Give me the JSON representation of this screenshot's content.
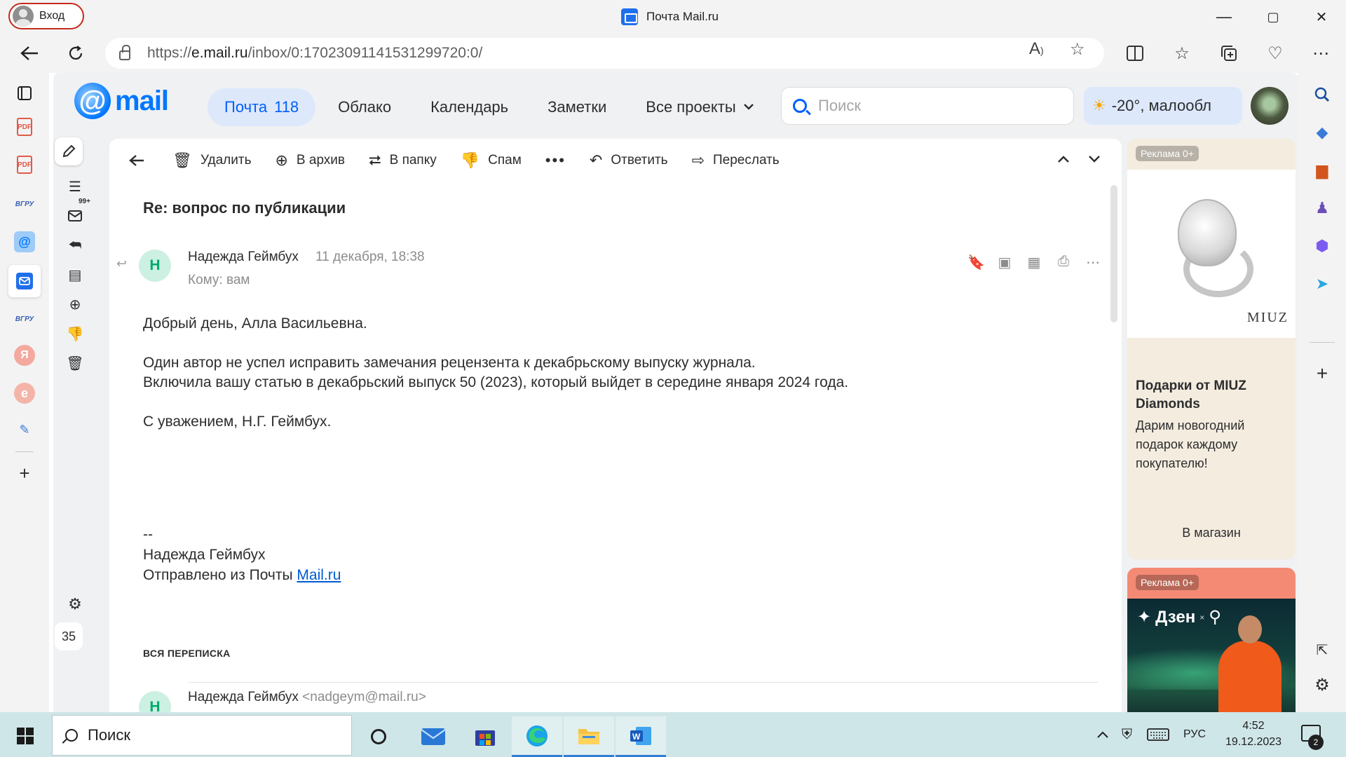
{
  "browser": {
    "profile_label": "Вход",
    "window_title": "Почта Mail.ru",
    "url_scheme": "https://",
    "url_host": "e.mail.ru",
    "url_path": "/inbox/0:17023091141531299720:0/",
    "window_controls": {
      "minimize": "—",
      "maximize": "▢",
      "close": "✕"
    }
  },
  "edge_left_icons": [
    "tabs-icon",
    "pdf-icon",
    "pdf-icon",
    "vgru-icon",
    "mailru-at-icon",
    "mail-icon",
    "vgru-icon",
    "yandex-icon",
    "edge-icon",
    "notes-icon",
    "add-icon"
  ],
  "edge_left_labels": {
    "vgru1": "ВГРУ",
    "vgru2": "ВГРУ",
    "yandex": "Я",
    "pdf1": "PDF",
    "pdf2": "PDF"
  },
  "mail": {
    "logo_text": "mail",
    "nav": {
      "mail": "Почта",
      "mail_count": "118",
      "cloud": "Облако",
      "calendar": "Календарь",
      "notes": "Заметки",
      "all_projects": "Все проекты"
    },
    "search_placeholder": "Поиск",
    "weather": "-20°, малообл",
    "tools": {
      "folder_badge": "99+",
      "day": "35"
    },
    "toolbar": {
      "delete": "Удалить",
      "archive": "В архив",
      "to_folder": "В папку",
      "spam": "Спам",
      "reply": "Ответить",
      "forward": "Переслать"
    },
    "letter": {
      "subject": "Re: вопрос по публикации",
      "sender_initial": "Н",
      "sender_name": "Надежда Геймбух",
      "date": "11 декабря, 18:38",
      "to": "Кому: вам",
      "greeting": "Добрый день, Алла Васильевна.",
      "paragraph": "Один автор не успел исправить замечания рецензента к декабрьскому выпуску журнала.\nВключила вашу статью в декабрьский выпуск 50 (2023), который выйдет в середине января 2024 года.",
      "closing": "С уважением, Н.Г. Геймбух.",
      "sig_dashes": "--",
      "sig_name": "Надежда Геймбух",
      "sig_sent_from": "Отправлено из Почты ",
      "sig_link": "Mail.ru",
      "thread_label": "ВСЯ ПЕРЕПИСКА",
      "thread_from": "Надежда Геймбух",
      "thread_email": "<nadgeym@mail.ru>",
      "thread_initial": "Н"
    }
  },
  "ads": {
    "ad1": {
      "badge": "Реклама 0+",
      "brand": "MIUZ",
      "title": "Подарки от MIUZ Diamonds",
      "text": "Дарим новогодний подарок каждому покупателю!",
      "cta": "В магазин"
    },
    "ad2": {
      "badge": "Реклама 0+",
      "brand": "Дзен",
      "brand_x": "×"
    }
  },
  "taskbar": {
    "search_placeholder": "Поиск",
    "language": "РУС",
    "time": "4:52",
    "date": "19.12.2023",
    "notifications": "2"
  },
  "colors": {
    "accent": "#005ff9",
    "nav_active_bg": "#dde8fb",
    "avatar_green": "#00a870",
    "ad1_bg": "#f4ecdf",
    "ad2_bg": "#f48a74",
    "taskbar_bg": "#cfe6e8"
  }
}
